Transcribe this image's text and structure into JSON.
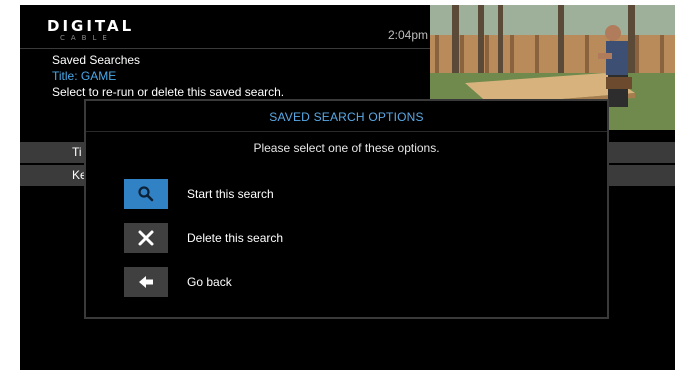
{
  "logo": {
    "main": "DIGITAL",
    "sub": "CABLE"
  },
  "clock": "2:04pm",
  "header": {
    "heading": "Saved Searches",
    "title_line": "Title: GAME",
    "instruction": "Select to re-run or delete this saved search."
  },
  "background_rows": [
    {
      "label": "Ti"
    },
    {
      "label": "Ke"
    }
  ],
  "dialog": {
    "title": "SAVED SEARCH OPTIONS",
    "subtitle": "Please select one of these options.",
    "options": [
      {
        "label": "Start this search",
        "icon": "search-icon",
        "selected": true
      },
      {
        "label": "Delete this search",
        "icon": "close-icon",
        "selected": false
      },
      {
        "label": "Go back",
        "icon": "arrow-left-icon",
        "selected": false
      }
    ]
  },
  "colors": {
    "accent_blue": "#3182c4",
    "title_blue": "#5aa9e6",
    "info_blue": "#4aa8e8",
    "row_gray": "#3b3b3b"
  }
}
